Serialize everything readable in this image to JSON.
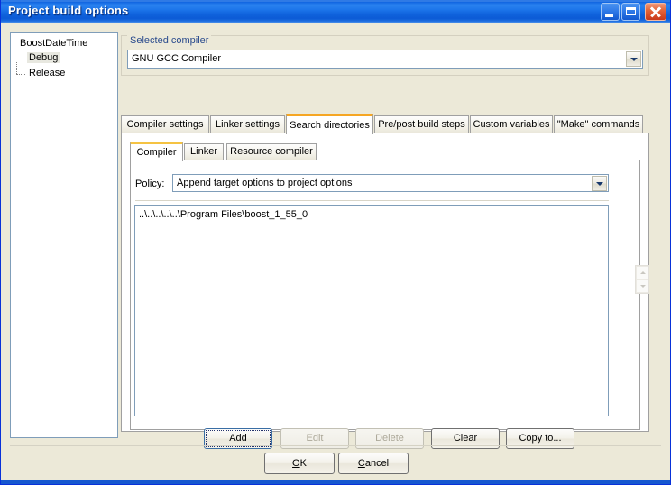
{
  "window": {
    "title": "Project build options",
    "controls": {
      "minimize": "Minimize",
      "maximize": "Maximize",
      "close": "Close"
    }
  },
  "tree": {
    "root": "BoostDateTime",
    "children": [
      {
        "label": "Debug",
        "selected": true
      },
      {
        "label": "Release",
        "selected": false
      }
    ]
  },
  "compiler_group": {
    "legend": "Selected compiler",
    "selected": "GNU GCC Compiler"
  },
  "tabs": [
    {
      "label": "Compiler settings",
      "active": false
    },
    {
      "label": "Linker settings",
      "active": false
    },
    {
      "label": "Search directories",
      "active": true
    },
    {
      "label": "Pre/post build steps",
      "active": false
    },
    {
      "label": "Custom variables",
      "active": false
    },
    {
      "label": "\"Make\" commands",
      "active": false
    }
  ],
  "subtabs": [
    {
      "label": "Compiler",
      "active": true
    },
    {
      "label": "Linker",
      "active": false
    },
    {
      "label": "Resource compiler",
      "active": false
    }
  ],
  "policy": {
    "label": "Policy:",
    "selected": "Append target options to project options"
  },
  "directories": [
    "..\\..\\..\\..\\..\\Program Files\\boost_1_55_0"
  ],
  "action_buttons": [
    {
      "label": "Add",
      "state": "focused"
    },
    {
      "label": "Edit",
      "state": "disabled"
    },
    {
      "label": "Delete",
      "state": "disabled"
    },
    {
      "label": "Clear",
      "state": "normal"
    },
    {
      "label": "Copy to...",
      "state": "normal"
    }
  ],
  "dialog_buttons": {
    "ok": {
      "accel": "O",
      "rest": "K"
    },
    "cancel": {
      "accel": "C",
      "rest": "ancel"
    }
  },
  "colors": {
    "title_bar": "#1063dd",
    "dialog_face": "#ece9d8",
    "active_tab_accent": "#f5a623",
    "group_label": "#2a4b8d",
    "close_button": "#c8391a"
  }
}
